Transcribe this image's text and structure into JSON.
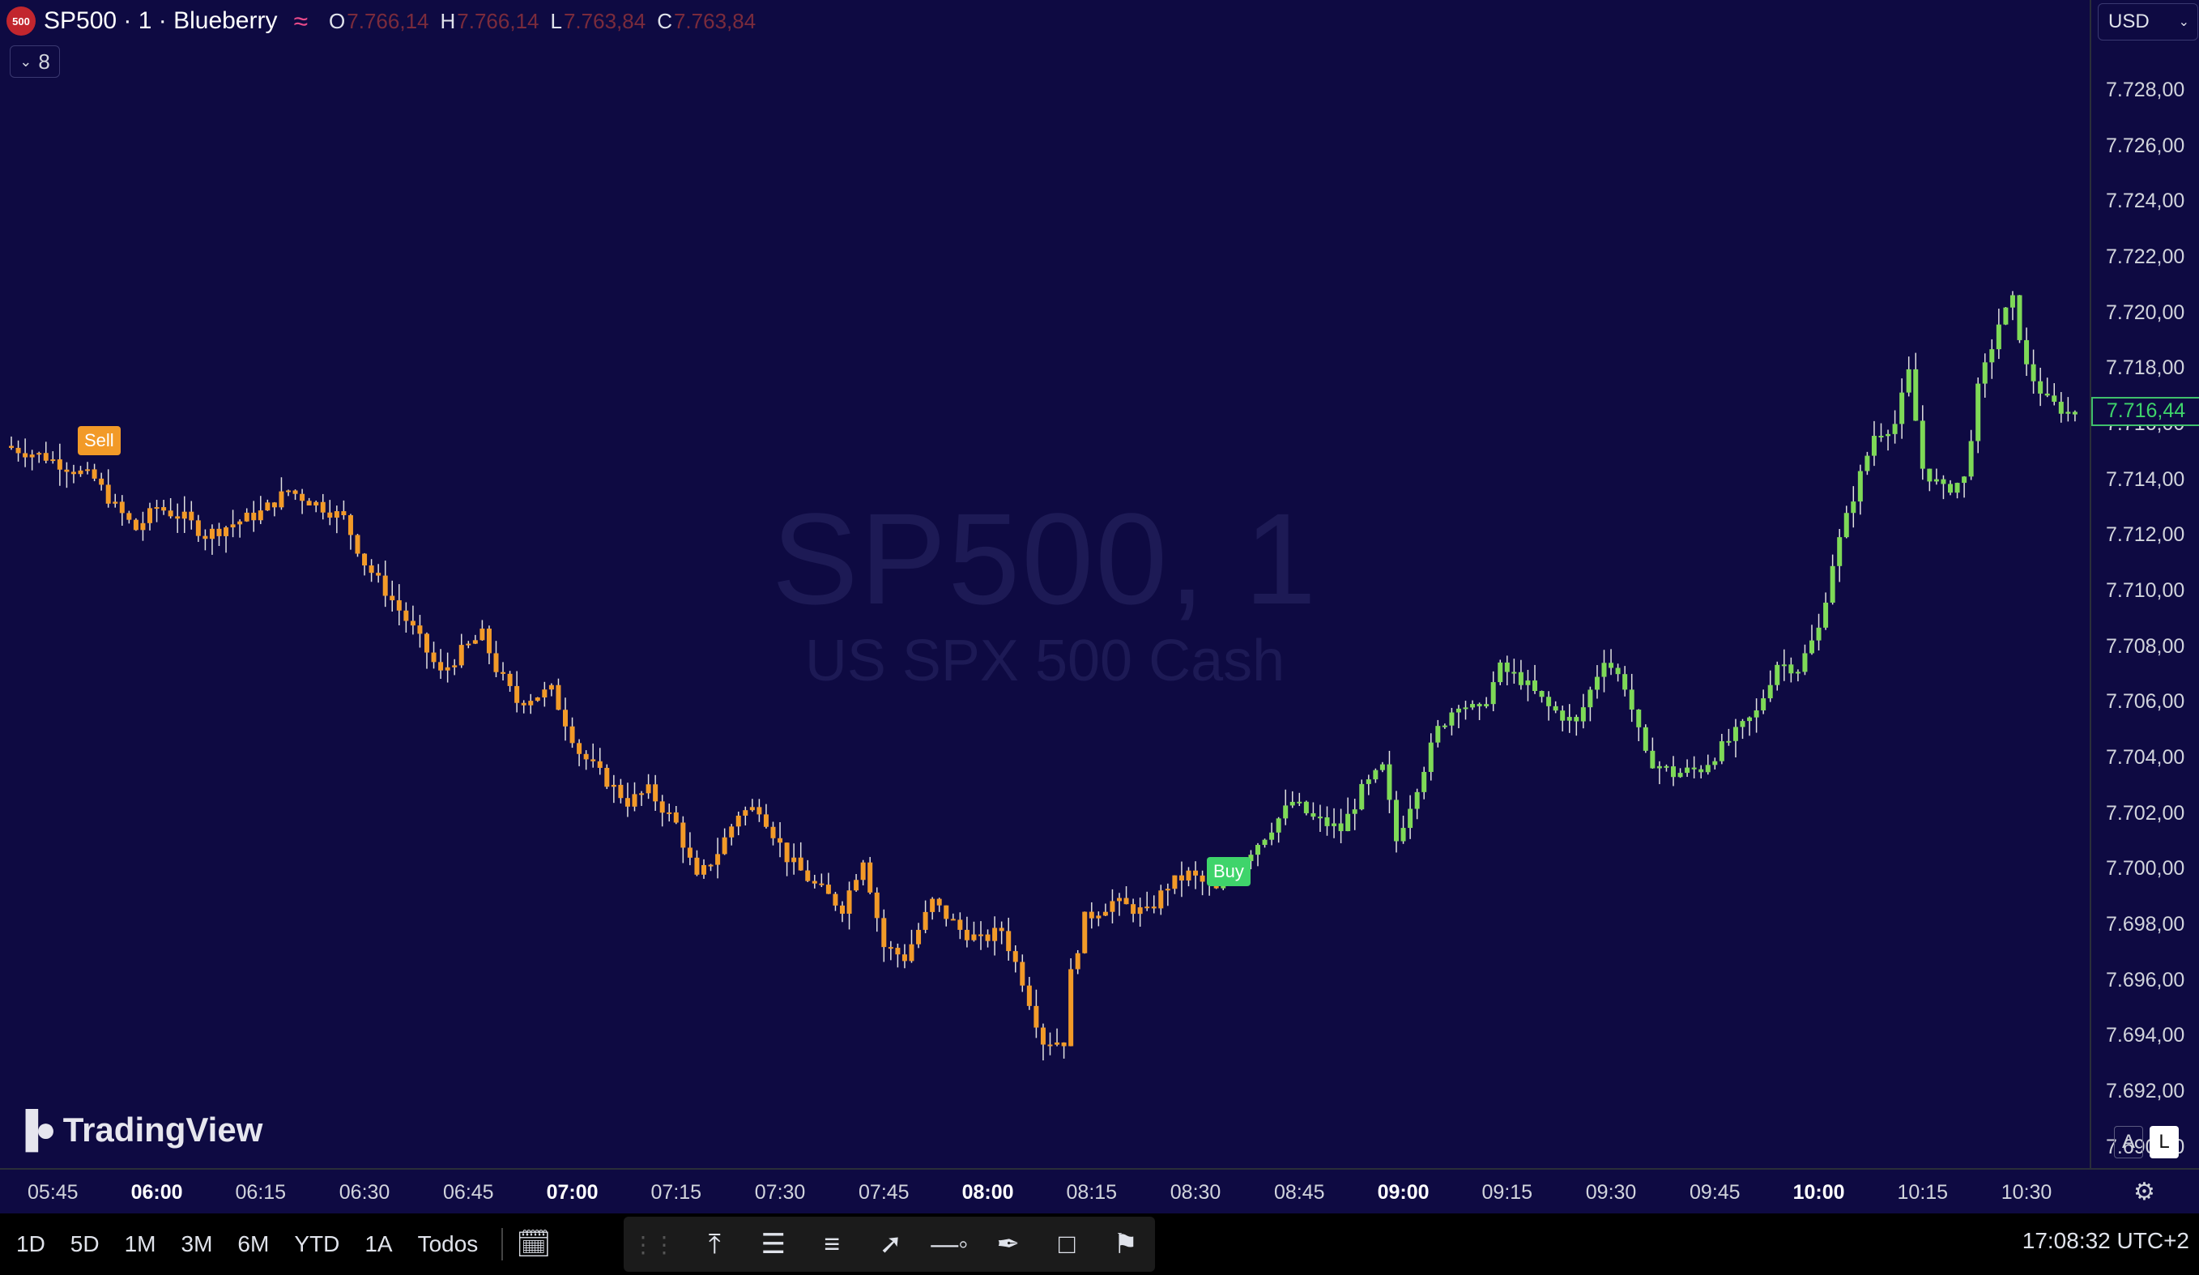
{
  "symbol": {
    "logo_text": "500",
    "title": "SP500 · 1 · Blueberry",
    "description_watermark_symbol": "SP500, 1",
    "description_watermark_name": "US SPX 500 Cash",
    "wave_icon": "wave-icon"
  },
  "ohlc": {
    "o_label": "O",
    "o": "7.766,14",
    "h_label": "H",
    "h": "7.766,14",
    "l_label": "L",
    "l": "7.763,84",
    "c_label": "C",
    "c": "7.763,84"
  },
  "indicators_button": {
    "count": "8",
    "icon": "chevron-down-icon"
  },
  "price_axis": {
    "currency": "USD",
    "last_price": "7.716,44",
    "auto_label": "A",
    "log_label": "L"
  },
  "time_axis": {
    "settings_icon": "gear-icon"
  },
  "signals": {
    "sell": "Sell",
    "buy": "Buy"
  },
  "logo": {
    "mark": "TV",
    "name": "TradingView"
  },
  "bottom_bar": {
    "ranges": [
      "1D",
      "5D",
      "1M",
      "3M",
      "6M",
      "YTD",
      "1A",
      "Todos"
    ],
    "clock": "17:08:32 UTC+2"
  },
  "colors": {
    "background": "#0e0a42",
    "up": "#7ed957",
    "down": "#f29a28",
    "wick": "#e0e0e0",
    "last_price": "#3fd46b"
  },
  "chart_data": {
    "type": "candlestick",
    "interval": "1",
    "ylim": [
      7689,
      7731
    ],
    "y_ticks": [
      "7.690,00",
      "7.692,00",
      "7.694,00",
      "7.696,00",
      "7.698,00",
      "7.700,00",
      "7.702,00",
      "7.704,00",
      "7.706,00",
      "7.708,00",
      "7.710,00",
      "7.712,00",
      "7.714,00",
      "7.716,00",
      "7.718,00",
      "7.720,00",
      "7.722,00",
      "7.724,00",
      "7.726,00",
      "7.728,00"
    ],
    "y_tick_values": [
      7690,
      7692,
      7694,
      7696,
      7698,
      7700,
      7702,
      7704,
      7706,
      7708,
      7710,
      7712,
      7714,
      7716,
      7718,
      7720,
      7722,
      7724,
      7726,
      7728
    ],
    "x_ticks": [
      {
        "label": "05:45",
        "major": false
      },
      {
        "label": "06:00",
        "major": true
      },
      {
        "label": "06:15",
        "major": false
      },
      {
        "label": "06:30",
        "major": false
      },
      {
        "label": "06:45",
        "major": false
      },
      {
        "label": "07:00",
        "major": true
      },
      {
        "label": "07:15",
        "major": false
      },
      {
        "label": "07:30",
        "major": false
      },
      {
        "label": "07:45",
        "major": false
      },
      {
        "label": "08:00",
        "major": true
      },
      {
        "label": "08:15",
        "major": false
      },
      {
        "label": "08:30",
        "major": false
      },
      {
        "label": "08:45",
        "major": false
      },
      {
        "label": "09:00",
        "major": true
      },
      {
        "label": "09:15",
        "major": false
      },
      {
        "label": "09:30",
        "major": false
      },
      {
        "label": "09:45",
        "major": false
      },
      {
        "label": "10:00",
        "major": true
      },
      {
        "label": "10:15",
        "major": false
      },
      {
        "label": "10:30",
        "major": false
      }
    ],
    "x_start": "05:39",
    "x_minutes_per_tick": 15,
    "path_points": [
      {
        "t": "05:39",
        "p": 7715.2
      },
      {
        "t": "05:45",
        "p": 7714.8
      },
      {
        "t": "05:52",
        "p": 7714.0
      },
      {
        "t": "05:55",
        "p": 7713.0
      },
      {
        "t": "05:58",
        "p": 7712.2
      },
      {
        "t": "06:01",
        "p": 7713.0
      },
      {
        "t": "06:05",
        "p": 7712.6
      },
      {
        "t": "06:08",
        "p": 7712.0
      },
      {
        "t": "06:12",
        "p": 7712.4
      },
      {
        "t": "06:16",
        "p": 7712.8
      },
      {
        "t": "06:20",
        "p": 7713.6
      },
      {
        "t": "06:25",
        "p": 7713.0
      },
      {
        "t": "06:28",
        "p": 7712.6
      },
      {
        "t": "06:31",
        "p": 7711.0
      },
      {
        "t": "06:34",
        "p": 7710.0
      },
      {
        "t": "06:38",
        "p": 7708.6
      },
      {
        "t": "06:42",
        "p": 7707.0
      },
      {
        "t": "06:45",
        "p": 7707.8
      },
      {
        "t": "06:48",
        "p": 7708.4
      },
      {
        "t": "06:50",
        "p": 7707.2
      },
      {
        "t": "06:53",
        "p": 7706.0
      },
      {
        "t": "06:58",
        "p": 7706.4
      },
      {
        "t": "07:02",
        "p": 7704.2
      },
      {
        "t": "07:05",
        "p": 7703.4
      },
      {
        "t": "07:09",
        "p": 7702.4
      },
      {
        "t": "07:12",
        "p": 7702.8
      },
      {
        "t": "07:16",
        "p": 7701.6
      },
      {
        "t": "07:19",
        "p": 7699.6
      },
      {
        "t": "07:22",
        "p": 7700.6
      },
      {
        "t": "07:25",
        "p": 7702.0
      },
      {
        "t": "07:28",
        "p": 7702.2
      },
      {
        "t": "07:32",
        "p": 7700.4
      },
      {
        "t": "07:36",
        "p": 7699.4
      },
      {
        "t": "07:40",
        "p": 7698.6
      },
      {
        "t": "07:43",
        "p": 7700.4
      },
      {
        "t": "07:46",
        "p": 7697.2
      },
      {
        "t": "07:49",
        "p": 7696.8
      },
      {
        "t": "07:53",
        "p": 7698.8
      },
      {
        "t": "07:57",
        "p": 7697.8
      },
      {
        "t": "08:00",
        "p": 7697.4
      },
      {
        "t": "08:03",
        "p": 7697.8
      },
      {
        "t": "08:06",
        "p": 7696.0
      },
      {
        "t": "08:09",
        "p": 7693.8
      },
      {
        "t": "08:12",
        "p": 7693.8
      },
      {
        "t": "08:13",
        "p": 7696.2
      },
      {
        "t": "08:15",
        "p": 7698.2
      },
      {
        "t": "08:19",
        "p": 7698.8
      },
      {
        "t": "08:24",
        "p": 7698.4
      },
      {
        "t": "08:27",
        "p": 7699.4
      },
      {
        "t": "08:30",
        "p": 7699.8
      },
      {
        "t": "08:34",
        "p": 7699.2
      },
      {
        "t": "08:38",
        "p": 7700.4
      },
      {
        "t": "08:41",
        "p": 7701.2
      },
      {
        "t": "08:45",
        "p": 7702.4
      },
      {
        "t": "08:48",
        "p": 7701.8
      },
      {
        "t": "08:52",
        "p": 7701.4
      },
      {
        "t": "08:55",
        "p": 7702.8
      },
      {
        "t": "08:58",
        "p": 7703.6
      },
      {
        "t": "09:00",
        "p": 7701.0
      },
      {
        "t": "09:03",
        "p": 7703.0
      },
      {
        "t": "09:06",
        "p": 7705.0
      },
      {
        "t": "09:09",
        "p": 7706.0
      },
      {
        "t": "09:12",
        "p": 7705.6
      },
      {
        "t": "09:15",
        "p": 7707.2
      },
      {
        "t": "09:18",
        "p": 7706.8
      },
      {
        "t": "09:22",
        "p": 7705.8
      },
      {
        "t": "09:26",
        "p": 7705.2
      },
      {
        "t": "09:28",
        "p": 7706.4
      },
      {
        "t": "09:30",
        "p": 7707.6
      },
      {
        "t": "09:33",
        "p": 7706.6
      },
      {
        "t": "09:36",
        "p": 7704.0
      },
      {
        "t": "09:40",
        "p": 7703.4
      },
      {
        "t": "09:44",
        "p": 7703.6
      },
      {
        "t": "09:48",
        "p": 7704.6
      },
      {
        "t": "09:52",
        "p": 7705.6
      },
      {
        "t": "09:55",
        "p": 7707.4
      },
      {
        "t": "09:58",
        "p": 7707.2
      },
      {
        "t": "10:01",
        "p": 7708.6
      },
      {
        "t": "10:03",
        "p": 7711.0
      },
      {
        "t": "10:06",
        "p": 7713.4
      },
      {
        "t": "10:09",
        "p": 7715.6
      },
      {
        "t": "10:12",
        "p": 7716.0
      },
      {
        "t": "10:14",
        "p": 7717.8
      },
      {
        "t": "10:16",
        "p": 7714.4
      },
      {
        "t": "10:19",
        "p": 7713.6
      },
      {
        "t": "10:22",
        "p": 7714.0
      },
      {
        "t": "10:24",
        "p": 7717.2
      },
      {
        "t": "10:27",
        "p": 7719.6
      },
      {
        "t": "10:29",
        "p": 7720.4
      },
      {
        "t": "10:31",
        "p": 7718.0
      },
      {
        "t": "10:34",
        "p": 7716.8
      },
      {
        "t": "10:37",
        "p": 7716.4
      }
    ],
    "signals": [
      {
        "label": "Sell",
        "t": "05:52",
        "p": 7714.0,
        "side": "above"
      },
      {
        "label": "Buy",
        "t": "08:34",
        "p": 7699.2,
        "side": "below"
      }
    ]
  }
}
